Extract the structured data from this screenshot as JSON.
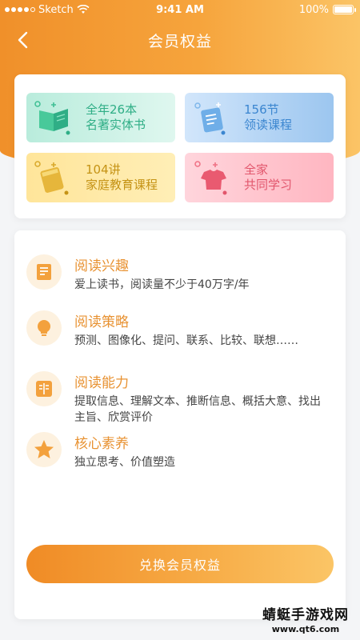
{
  "status_bar": {
    "carrier": "Sketch",
    "time": "9:41 AM",
    "battery": "100%"
  },
  "nav": {
    "title": "会员权益"
  },
  "tiles": [
    {
      "line1": "全年26本",
      "line2": "名著实体书",
      "icon": "book-icon"
    },
    {
      "line1": "156节",
      "line2": "领读课程",
      "icon": "document-icon"
    },
    {
      "line1": "104讲",
      "line2": "家庭教育课程",
      "icon": "textbook-icon"
    },
    {
      "line1": "全家",
      "line2": "共同学习",
      "icon": "shirt-icon"
    }
  ],
  "benefits": [
    {
      "title": "阅读兴趣",
      "desc": "爱上读书，阅读量不少于40万字/年",
      "icon": "bookmark-icon"
    },
    {
      "title": "阅读策略",
      "desc": "预测、图像化、提问、联系、比较、联想……",
      "icon": "lightbulb-icon"
    },
    {
      "title": "阅读能力",
      "desc": "提取信息、理解文本、推断信息、概括大意、找出主旨、欣赏评价",
      "icon": "open-book-icon"
    },
    {
      "title": "核心素养",
      "desc": "独立思考、价值塑造",
      "icon": "star-icon"
    }
  ],
  "redeem_button": "兑换会员权益",
  "watermark": {
    "title": "蜻蜓手游戏网",
    "url": "www.qt6.com"
  },
  "colors": {
    "accent": "#f39a33",
    "title_orange": "#e89232"
  }
}
